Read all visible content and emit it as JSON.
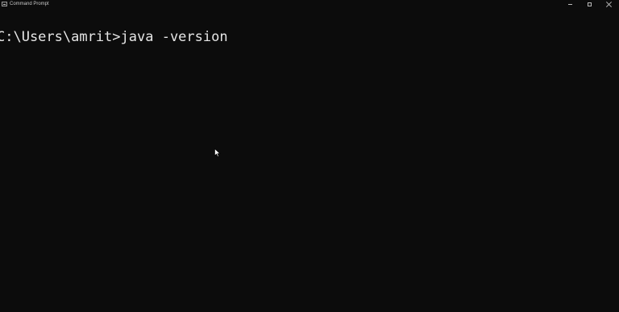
{
  "window": {
    "title": "Command Prompt",
    "app_icon": "terminal-icon",
    "controls": [
      "minimize-icon",
      "maximize-icon",
      "close-icon"
    ]
  },
  "console": {
    "prompt": "C:\\Users\\amrit>",
    "command": "java -version"
  },
  "colors": {
    "background": "#0c0c0c",
    "text": "#e6e6e6"
  }
}
